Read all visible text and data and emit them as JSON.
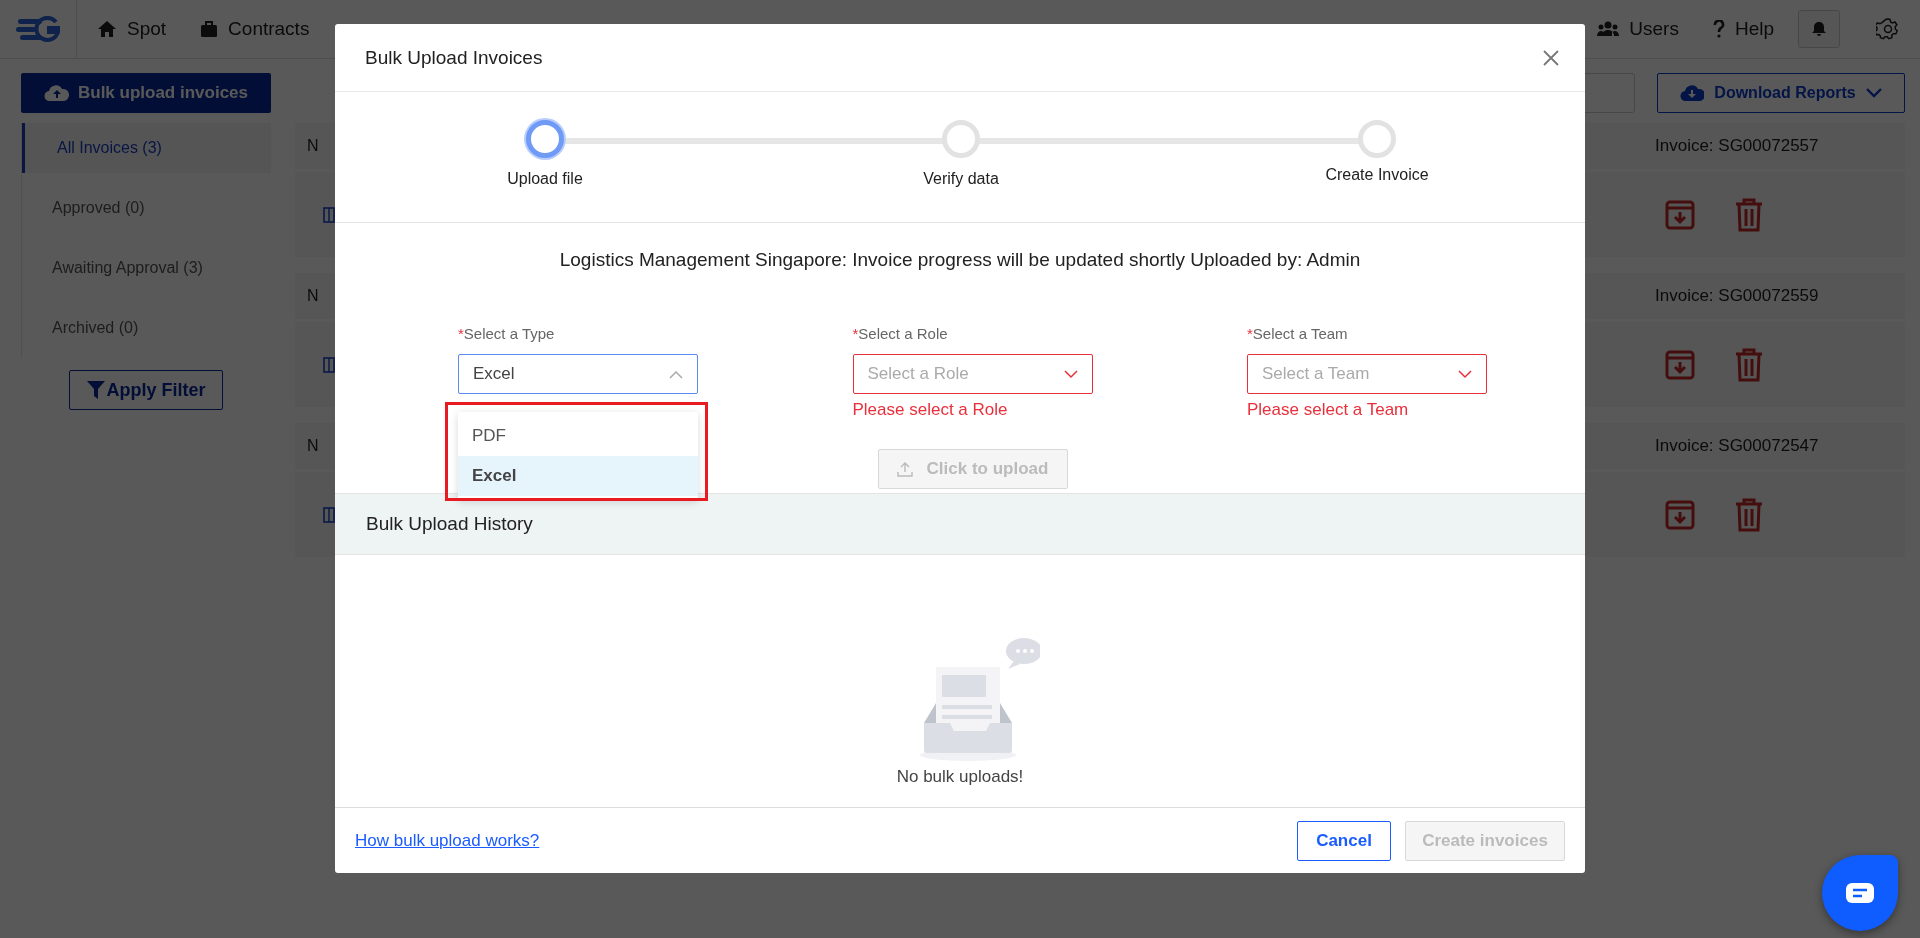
{
  "nav": {
    "items": [
      {
        "label": "Spot"
      },
      {
        "label": "Contracts"
      }
    ],
    "right": [
      {
        "label": "Users"
      },
      {
        "label": "Help"
      }
    ]
  },
  "sidebar": {
    "upload_button": "Bulk upload invoices",
    "filters": [
      {
        "label": "All Invoices (3)",
        "selected": true
      },
      {
        "label": "Approved (0)",
        "selected": false
      },
      {
        "label": "Awaiting Approval (3)",
        "selected": false
      },
      {
        "label": "Archived (0)",
        "selected": false
      }
    ],
    "apply_button": "Apply Filter"
  },
  "toolbar": {
    "download_button": "Download Reports"
  },
  "invoices": [
    {
      "column_1": "N",
      "invoice": "Invoice: SG00072557"
    },
    {
      "column_1": "N",
      "invoice": "Invoice: SG00072559"
    },
    {
      "column_1": "N",
      "invoice": "Invoice: SG00072547"
    }
  ],
  "modal": {
    "title": "Bulk Upload Invoices",
    "steps": [
      {
        "label": "Upload file",
        "selected": true
      },
      {
        "label": "Verify data",
        "selected": false
      },
      {
        "label": "Create Invoice",
        "selected": false
      }
    ],
    "info": "Logistics Management Singapore: Invoice progress will be updated shortly Uploaded by: Admin",
    "fields": [
      {
        "label": "Select a Type",
        "required_mark": "*",
        "value": "Excel",
        "expanded": true,
        "options": [
          {
            "label": "PDF",
            "selected": false
          },
          {
            "label": "Excel",
            "selected": true
          }
        ]
      },
      {
        "label": "Select a Role",
        "required_mark": "*",
        "placeholder": "Select a Role",
        "error": "Please select a Role",
        "expanded": false
      },
      {
        "label": "Select a Team",
        "required_mark": "*",
        "placeholder": "Select a Team",
        "error": "Please select a Team",
        "expanded": false
      }
    ],
    "upload_button": {
      "label": "Click to upload",
      "disabled": true
    },
    "history": {
      "title": "Bulk Upload History",
      "empty_text": "No bulk uploads!"
    },
    "help_link": "How bulk upload works?",
    "cancel_button": "Cancel",
    "create_button": {
      "label": "Create invoices",
      "disabled": true
    }
  }
}
